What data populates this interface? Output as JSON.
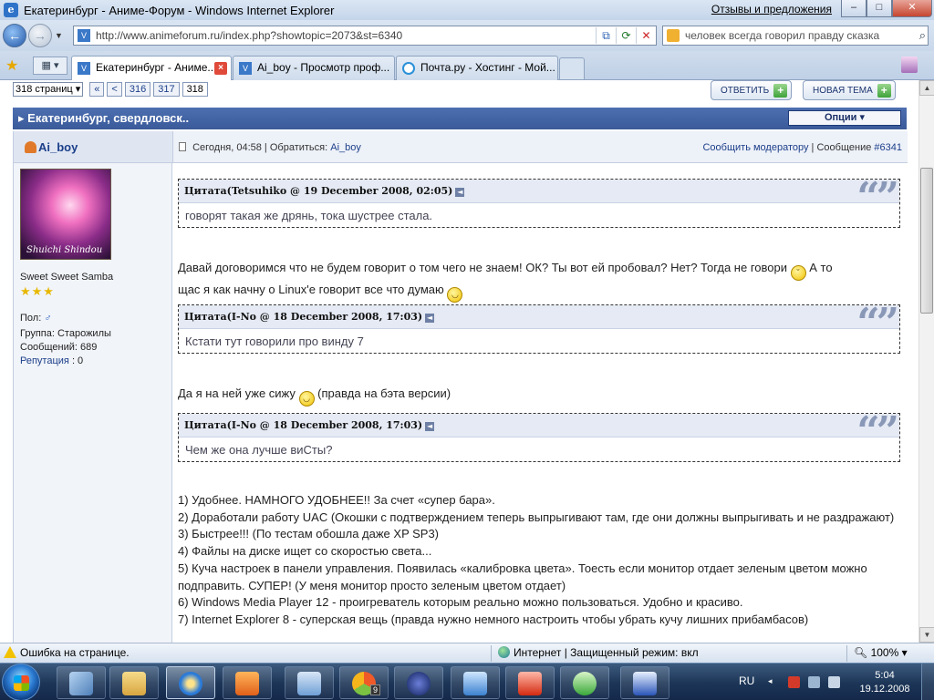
{
  "window": {
    "title": "Екатеринбург - Аниме-Форум - Windows Internet Explorer",
    "feedback_link": "Отзывы и предложения",
    "minimize": "–",
    "maximize": "□",
    "close": "✕"
  },
  "address_bar": {
    "url": "http://www.animeforum.ru/index.php?showtopic=2073&st=6340",
    "search_value": "человек всегда говорил правду сказка"
  },
  "tabs": [
    {
      "label": "Екатеринбург - Аниме...",
      "active": true
    },
    {
      "label": "Ai_boy - Просмотр проф...",
      "active": false
    },
    {
      "label": "Почта.ру - Хостинг - Мой...",
      "active": false
    }
  ],
  "pagination": {
    "pages_select": "318 страниц",
    "first": "«",
    "prev": "<",
    "pages": [
      "316",
      "317",
      "318"
    ],
    "current": "318"
  },
  "actions": {
    "reply": "ОТВЕТИТЬ",
    "new_topic": "НОВАЯ ТЕМА"
  },
  "forum": {
    "topic_title": "Екатеринбург, свердловск..",
    "options": "Опции"
  },
  "post": {
    "author": "Ai_boy",
    "date_text": "Сегодня, 04:58",
    "separator": "|",
    "address_label": "Обратиться:",
    "address_name": "Ai_boy",
    "report": "Сообщить модератору",
    "message_label": "Сообщение",
    "message_number": "#6341",
    "user": {
      "avatar_signature": "Shuichi Shindou",
      "status": "Sweet Sweet Samba",
      "stars": "★★★",
      "gender_label": "Пол:",
      "gender_icon": "♂",
      "group": "Группа: Старожилы",
      "messages": "Сообщений: 689",
      "reputation_label": "Репутация",
      "reputation_value": ": 0"
    },
    "quote1": {
      "head": "Цитата(Tetsuhiko @ 19 December 2008, 02:05)",
      "text": "говорят такая же дрянь, тока шустрее стала."
    },
    "para1a": "Давай договоримся что не будем говорит о том чего не знаем! ОК? Ты вот ей пробовал? Нет? Тогда не говори",
    "para1b": "А то",
    "para1c": "щас я как начну о Linux'е говорит все что думаю",
    "quote2": {
      "head": "Цитата(I-No @ 18 December 2008, 17:03)",
      "text": "Кстати тут говорили про винду 7"
    },
    "para2a": "Да я на ней уже сижу",
    "para2b": "(правда на бэта версии)",
    "quote3": {
      "head": "Цитата(I-No @ 18 December 2008, 17:03)",
      "text": "Чем же она лучше виСты?"
    },
    "list": [
      "1) Удобнее. НАМНОГО УДОБНЕЕ!! За счет «супер бара».",
      "2) Доработали работу UAC (Окошки с подтверждением теперь выпрыгивают там, где они должны выпрыгивать и не раздражают)",
      "3) Быстрее!!! (По тестам обошла даже XP SP3)",
      "4) Файлы на диске ищет со скоростью света...",
      "5) Куча настроек в панели управления. Появилась «калибровка цвета». Тоесть если монитор отдает зеленым цветом можно подправить. СУПЕР! (У меня монитор просто зеленым цветом отдает)",
      "6) Windows Media Player 12 - проигреватель которым реально можно пользоваться. Удобно и красиво.",
      "7) Internet Explorer 8 - суперская вещь (правда нужно немного настроить чтобы убрать кучу лишних прибамбасов)"
    ]
  },
  "statusbar": {
    "error": "Ошибка на странице.",
    "zone": "Интернет | Защищенный режим: вкл",
    "zoom": "100%"
  },
  "taskbar": {
    "lang": "RU",
    "time": "5:04",
    "date": "19.12.2008",
    "badge": "9"
  },
  "colors": {
    "forum_header": "#3a5a9a",
    "link": "#1c3f8a",
    "post_header_bg": "#edf1f8",
    "quote_head_bg": "#e5eaf4"
  }
}
